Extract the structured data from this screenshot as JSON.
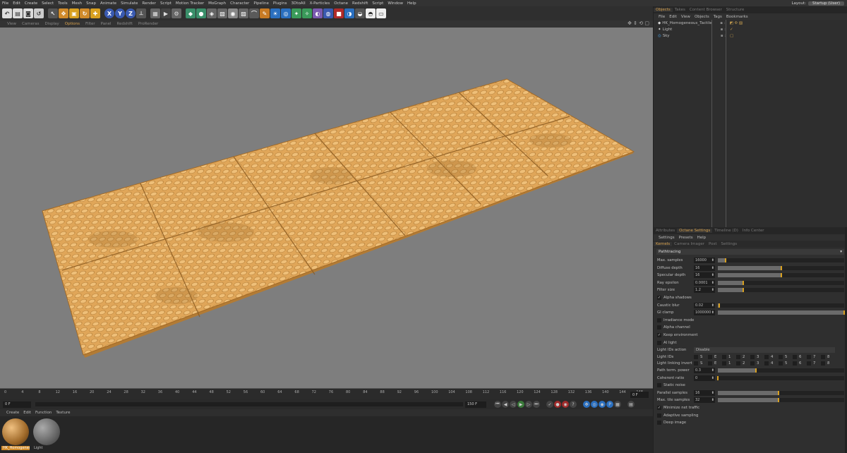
{
  "menu": [
    "File",
    "Edit",
    "Create",
    "Select",
    "Tools",
    "Mesh",
    "Snap",
    "Animate",
    "Simulate",
    "Render",
    "Script",
    "Motion Tracker",
    "MoGraph",
    "Character",
    "Pipeline",
    "Plugins",
    "3DtoAll",
    "X-Particles",
    "Octane",
    "Redshift",
    "Script",
    "Window",
    "Help"
  ],
  "layout": {
    "label": "Layout:",
    "value": "Startup (User)"
  },
  "toolbar": {
    "x": "X",
    "y": "Y",
    "z": "Z"
  },
  "viewport_menu": [
    "View",
    "Cameras",
    "Display",
    "Options",
    "Filter",
    "Panel",
    "RedshIft",
    "ProRender"
  ],
  "viewport_active": "Options",
  "timeline": {
    "ticks": [
      "0",
      "4",
      "8",
      "12",
      "16",
      "20",
      "24",
      "28",
      "32",
      "36",
      "40",
      "44",
      "48",
      "52",
      "56",
      "60",
      "64",
      "68",
      "72",
      "76",
      "80",
      "84",
      "88",
      "92",
      "96",
      "100",
      "104",
      "108",
      "112",
      "116",
      "120",
      "124",
      "128",
      "132",
      "136",
      "140",
      "144",
      "148"
    ],
    "end_field": "0 F",
    "start_field": "0 F",
    "max_field": "150 F"
  },
  "material_menu": [
    "Create",
    "Edit",
    "Function",
    "Texture"
  ],
  "materials": [
    {
      "label": "HK_Homogeneou"
    },
    {
      "label": "Light"
    }
  ],
  "objects": {
    "tabs": [
      "Objects",
      "Takes",
      "Content Browser",
      "Structure"
    ],
    "menu": [
      "File",
      "Edit",
      "View",
      "Objects",
      "Tags",
      "Bookmarks"
    ],
    "rows": [
      "HK_Homogeneous_Tactile",
      "Light",
      "Sky"
    ]
  },
  "attributes": {
    "tabs": [
      "Attributes",
      "Octane Settings",
      "Timeline (D)",
      "Info Center"
    ],
    "menu": [
      "Settings",
      "Presets",
      "Help"
    ],
    "subtabs": [
      "Kernels",
      "Camera Imager",
      "Post",
      "Settings"
    ],
    "kernel": "Pathtracing",
    "rows": [
      {
        "label": "Max. samples",
        "value": "16000",
        "fill": 0.06
      },
      {
        "label": "Diffuse depth",
        "value": "16",
        "fill": 0.5
      },
      {
        "label": "Specular depth",
        "value": "16",
        "fill": 0.5
      },
      {
        "label": "Ray epsilon",
        "value": "0.0001",
        "fill": 0.2
      },
      {
        "label": "Filter size",
        "value": "1.2",
        "fill": 0.2
      },
      {
        "label": "Alpha shadows",
        "check": true
      },
      {
        "label": "Caustic blur",
        "value": "0.02",
        "fill": 0.01
      },
      {
        "label": "GI clamp",
        "value": "1000000",
        "fill": 1.0
      },
      {
        "label": "Irradiance mode",
        "check": false
      },
      {
        "label": "Alpha channel",
        "check": false
      },
      {
        "label": "Keep environment",
        "check": true
      },
      {
        "label": "AI light",
        "check": false
      },
      {
        "label": "Light IDs action",
        "select": "Disable"
      },
      {
        "label": "Light IDs",
        "ids": [
          "S",
          "E",
          "1",
          "2",
          "3",
          "4",
          "5",
          "6",
          "7",
          "8"
        ]
      },
      {
        "label": "Light linking invert",
        "ids": [
          "S",
          "E",
          "1",
          "2",
          "3",
          "4",
          "5",
          "6",
          "7",
          "8"
        ]
      },
      {
        "label": "Path term. power",
        "value": "0.3",
        "fill": 0.3
      },
      {
        "label": "Coherent ratio",
        "value": "0",
        "fill": 0.0
      },
      {
        "label": "Static noise",
        "check": false
      },
      {
        "label": "Parallel samples",
        "value": "16",
        "fill": 0.48
      },
      {
        "label": "Max. tile samples",
        "value": "32",
        "fill": 0.48
      },
      {
        "label": "Minimize net traffic",
        "check": true
      },
      {
        "label": "Adaptive sampling",
        "check": false
      },
      {
        "label": "Deep image",
        "check": false
      }
    ]
  }
}
